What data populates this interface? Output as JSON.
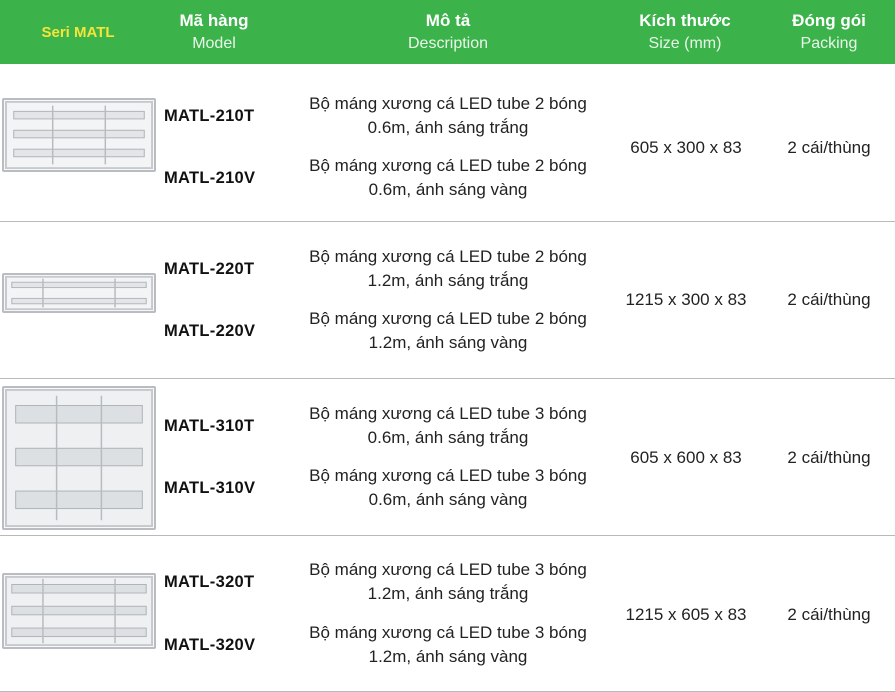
{
  "header": {
    "series": "Seri MATL",
    "model_vi": "Mã hàng",
    "model_en": "Model",
    "desc_vi": "Mô tả",
    "desc_en": "Description",
    "size_vi": "Kích thước",
    "size_en": "Size (mm)",
    "pack_vi": "Đóng gói",
    "pack_en": "Packing"
  },
  "colors": {
    "header_bg": "#3bb34a",
    "series_text": "#f7e43a",
    "header_text": "#ffffff",
    "divider": "#b9b9b9"
  },
  "rows": [
    {
      "image": "product-image-2-tube-0.6m",
      "model_a": "MATL-210T",
      "model_b": "MATL-210V",
      "desc_a_1": "Bộ máng xương cá LED tube 2 bóng",
      "desc_a_2": "0.6m, ánh sáng trắng",
      "desc_b_1": "Bộ máng xương cá LED tube 2 bóng",
      "desc_b_2": "0.6m, ánh sáng vàng",
      "size": "605 x 300 x 83",
      "packing": "2 cái/thùng"
    },
    {
      "image": "product-image-2-tube-1.2m",
      "model_a": "MATL-220T",
      "model_b": "MATL-220V",
      "desc_a_1": "Bộ máng xương cá LED tube 2 bóng",
      "desc_a_2": "1.2m, ánh sáng trắng",
      "desc_b_1": "Bộ máng xương cá LED tube 2 bóng",
      "desc_b_2": "1.2m, ánh sáng vàng",
      "size": "1215 x 300 x 83",
      "packing": "2 cái/thùng"
    },
    {
      "image": "product-image-3-tube-0.6m",
      "model_a": "MATL-310T",
      "model_b": "MATL-310V",
      "desc_a_1": "Bộ máng xương cá LED tube 3 bóng",
      "desc_a_2": "0.6m, ánh sáng trắng",
      "desc_b_1": "Bộ máng xương cá LED tube 3 bóng",
      "desc_b_2": "0.6m, ánh sáng vàng",
      "size": "605 x 600 x 83",
      "packing": "2 cái/thùng"
    },
    {
      "image": "product-image-3-tube-1.2m",
      "model_a": "MATL-320T",
      "model_b": "MATL-320V",
      "desc_a_1": "Bộ máng xương cá LED tube 3 bóng",
      "desc_a_2": "1.2m, ánh sáng trắng",
      "desc_b_1": "Bộ máng xương cá LED tube 3 bóng",
      "desc_b_2": "1.2m, ánh sáng vàng",
      "size": "1215 x 605 x 83",
      "packing": "2 cái/thùng"
    }
  ]
}
